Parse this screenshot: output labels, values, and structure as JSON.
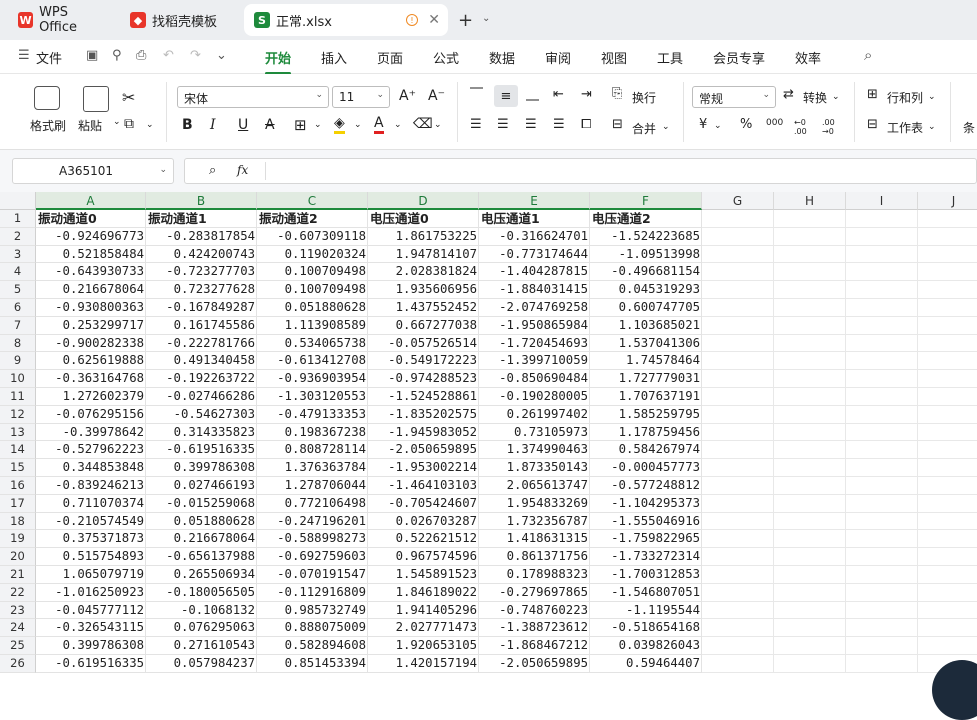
{
  "tabs": [
    {
      "label": "WPS Office",
      "icon": "wps-logo-icon"
    },
    {
      "label": "找稻壳模板",
      "icon": "docer-icon"
    },
    {
      "label": "正常.xlsx",
      "icon": "spreadsheet-icon"
    }
  ],
  "menu": {
    "file": "文件",
    "items": [
      "开始",
      "插入",
      "页面",
      "公式",
      "数据",
      "审阅",
      "视图",
      "工具",
      "会员专享",
      "效率"
    ],
    "active": "开始"
  },
  "ribbon": {
    "format_painter": "格式刷",
    "paste": "粘贴",
    "font_name": "宋体",
    "font_size": "11",
    "bold": "B",
    "italic": "I",
    "underline": "U",
    "strike": "A",
    "font_color_letter": "A",
    "wrap": "换行",
    "merge": "合并",
    "number_format": "常规",
    "convert": "转换",
    "rows_cols": "行和列",
    "worksheet": "工作表",
    "cond": "条",
    "currency": "¥",
    "percent": "%",
    "thousands": "000",
    "dec_inc": "←0 .00",
    "dec_dec": ".00 →0",
    "grow_font": "A⁺",
    "shrink_font": "A⁻",
    "colors": {
      "accent": "#1e8a3c",
      "fill_yellow": "#f5d000",
      "font_red": "#e02020"
    }
  },
  "formula_bar": {
    "name_box": "A365101",
    "fx": "fx",
    "content": ""
  },
  "columns": [
    "A",
    "B",
    "C",
    "D",
    "E",
    "F",
    "G",
    "H",
    "I",
    "J"
  ],
  "header_row": [
    "振动通道0",
    "振动通道1",
    "振动通道2",
    "电压通道0",
    "电压通道1",
    "电压通道2"
  ],
  "rows": [
    [
      "-0.924696773",
      "-0.283817854",
      "-0.607309118",
      "1.861753225",
      "-0.316624701",
      "-1.524223685"
    ],
    [
      "0.521858484",
      "0.424200743",
      "0.119020324",
      "1.947814107",
      "-0.773174644",
      "-1.09513998"
    ],
    [
      "-0.643930733",
      "-0.723277703",
      "0.100709498",
      "2.028381824",
      "-1.404287815",
      "-0.496681154"
    ],
    [
      "0.216678064",
      "0.723277628",
      "0.100709498",
      "1.935606956",
      "-1.884031415",
      "0.045319293"
    ],
    [
      "-0.930800363",
      "-0.167849287",
      "0.051880628",
      "1.437552452",
      "-2.074769258",
      "0.600747705"
    ],
    [
      "0.253299717",
      "0.161745586",
      "1.113908589",
      "0.667277038",
      "-1.950865984",
      "1.103685021"
    ],
    [
      "-0.900282338",
      "-0.222781766",
      "0.534065738",
      "-0.057526514",
      "-1.720454693",
      "1.537041306"
    ],
    [
      "0.625619888",
      "0.491340458",
      "-0.613412708",
      "-0.549172223",
      "-1.399710059",
      "1.74578464"
    ],
    [
      "-0.363164768",
      "-0.192263722",
      "-0.936903954",
      "-0.974288523",
      "-0.850690484",
      "1.727779031"
    ],
    [
      "1.272602379",
      "-0.027466286",
      "-1.303120553",
      "-1.524528861",
      "-0.190280005",
      "1.707637191"
    ],
    [
      "-0.076295156",
      "-0.54627303",
      "-0.479133353",
      "-1.835202575",
      "0.261997402",
      "1.585259795"
    ],
    [
      "-0.39978642",
      "0.314335823",
      "0.198367238",
      "-1.945983052",
      "0.73105973",
      "1.178759456"
    ],
    [
      "-0.527962223",
      "-0.619516335",
      "0.808728114",
      "-2.050659895",
      "1.374990463",
      "0.584267974"
    ],
    [
      "0.344853848",
      "0.399786308",
      "1.376363784",
      "-1.953002214",
      "1.873350143",
      "-0.000457773"
    ],
    [
      "-0.839246213",
      "0.027466193",
      "1.278706044",
      "-1.464103103",
      "2.065613747",
      "-0.577248812"
    ],
    [
      "0.711070374",
      "-0.015259068",
      "0.772106498",
      "-0.705424607",
      "1.954833269",
      "-1.104295373"
    ],
    [
      "-0.210574549",
      "0.051880628",
      "-0.247196201",
      "0.026703287",
      "1.732356787",
      "-1.555046916"
    ],
    [
      "0.375371873",
      "0.216678064",
      "-0.588998273",
      "0.522621512",
      "1.418631315",
      "-1.759822965"
    ],
    [
      "0.515754893",
      "-0.656137988",
      "-0.692759603",
      "0.967574596",
      "0.861371756",
      "-1.733272314"
    ],
    [
      "1.065079719",
      "0.265506934",
      "-0.070191547",
      "1.545891523",
      "0.178988323",
      "-1.700312853"
    ],
    [
      "-1.016250923",
      "-0.180056505",
      "-0.112916809",
      "1.846189022",
      "-0.279697865",
      "-1.546807051"
    ],
    [
      "-0.045777112",
      "-0.1068132",
      "0.985732749",
      "1.941405296",
      "-0.748760223",
      "-1.1195544"
    ],
    [
      "-0.326543115",
      "0.076295063",
      "0.888075009",
      "2.027771473",
      "-1.388723612",
      "-0.518654168"
    ],
    [
      "0.399786308",
      "0.271610543",
      "0.582894608",
      "1.920653105",
      "-1.868467212",
      "0.039826043"
    ],
    [
      "-0.619516335",
      "0.057984237",
      "0.851453394",
      "1.420157194",
      "-2.050659895",
      "0.59464407"
    ]
  ]
}
